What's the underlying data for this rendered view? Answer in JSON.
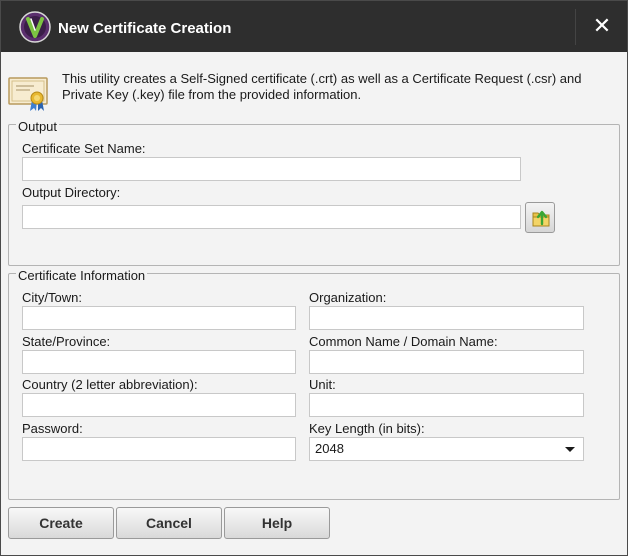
{
  "window": {
    "title": "New Certificate Creation",
    "close_symbol": "✕"
  },
  "icons": {
    "app": "app-logo-icon",
    "certificate": "certificate-icon",
    "browse": "folder-browse-icon",
    "close": "close-icon",
    "dropdown": "chevron-down-icon"
  },
  "description": "This utility creates a Self-Signed certificate (.crt) as well as a Certificate Request (.csr) and Private Key (.key) file from the provided information.",
  "output": {
    "legend": "Output",
    "cert_set_name_label": "Certificate Set Name:",
    "cert_set_name_value": "",
    "output_dir_label": "Output Directory:",
    "output_dir_value": ""
  },
  "cert_info": {
    "legend": "Certificate Information",
    "city_label": "City/Town:",
    "city_value": "",
    "organization_label": "Organization:",
    "organization_value": "",
    "state_label": "State/Province:",
    "state_value": "",
    "common_name_label": "Common Name / Domain Name:",
    "common_name_value": "",
    "country_label": "Country (2 letter abbreviation):",
    "country_value": "",
    "unit_label": "Unit:",
    "unit_value": "",
    "password_label": "Password:",
    "password_value": "",
    "key_length_label": "Key Length (in bits):",
    "key_length_value": "2048"
  },
  "buttons": {
    "create": "Create",
    "cancel": "Cancel",
    "help": "Help"
  },
  "colors": {
    "titlebar": "#2e2e2e",
    "dialog_bg": "#f3f3f3",
    "accent": "#6db33f"
  }
}
